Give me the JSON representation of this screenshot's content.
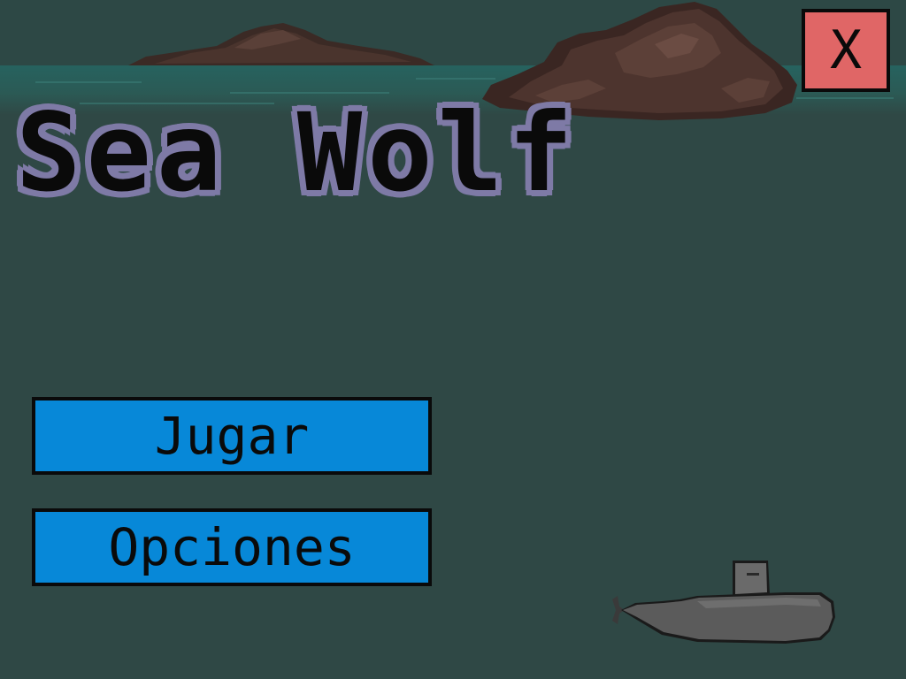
{
  "game": {
    "title": "Sea Wolf",
    "close_label": "X"
  },
  "menu": {
    "play_label": "Jugar",
    "options_label": "Opciones"
  },
  "colors": {
    "sea": "#2f4845",
    "title_outline": "#7e7aa6",
    "button_fill": "#0788d8",
    "close_fill": "#e06666"
  },
  "icons": [
    "island",
    "submarine"
  ]
}
